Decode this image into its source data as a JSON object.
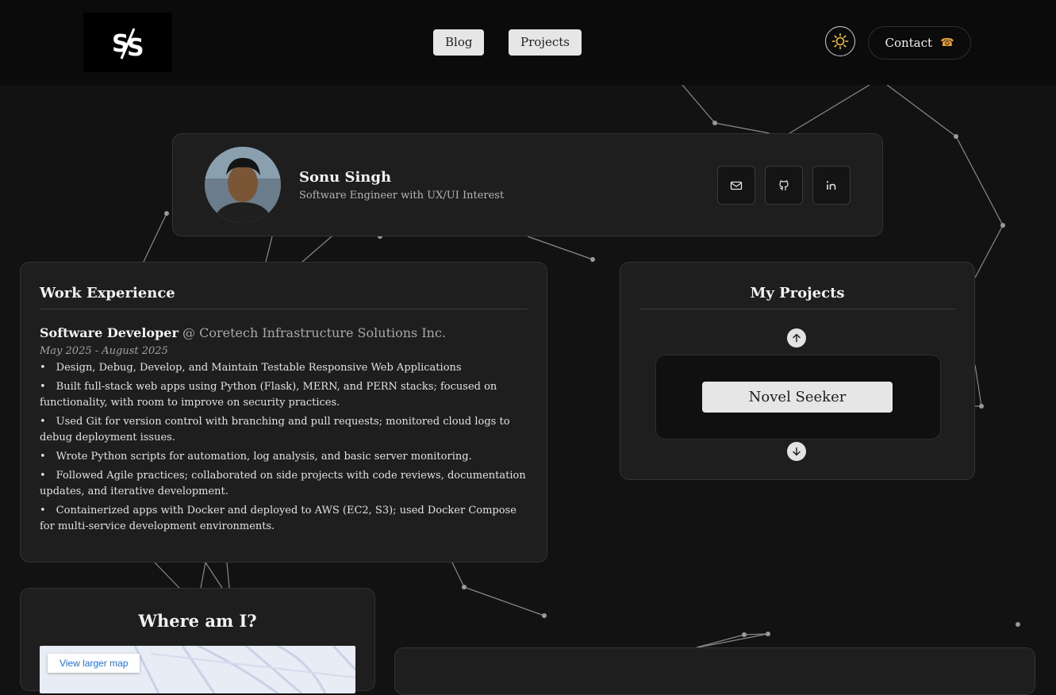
{
  "header": {
    "logo_text": "S/S",
    "nav": [
      {
        "label": "Blog"
      },
      {
        "label": "Projects"
      }
    ],
    "theme_icon": "sun-icon",
    "contact": {
      "label": "Contact",
      "icon": "telephone-icon",
      "icon_char": "☎"
    }
  },
  "profile": {
    "name": "Sonu Singh",
    "title": "Software Engineer with UX/UI Interest",
    "social": [
      "mail-icon",
      "github-icon",
      "linkedin-icon"
    ]
  },
  "work": {
    "heading": "Work Experience",
    "role": "Software Developer",
    "company": "@ Coretech Infrastructure Solutions Inc.",
    "dates": "May 2025 - August 2025",
    "bullets": [
      "Design, Debug, Develop, and Maintain Testable Responsive Web Applications",
      "Built full-stack web apps using Python (Flask), MERN, and PERN stacks; focused on functionality, with room to improve on security practices.",
      "Used Git for version control with branching and pull requests; monitored cloud logs to debug deployment issues.",
      "Wrote Python scripts for automation, log analysis, and basic server monitoring.",
      "Followed Agile practices; collaborated on side projects with code reviews, documentation updates, and iterative development.",
      "Containerized apps with Docker and deployed to AWS (EC2, S3); used Docker Compose for multi-service development environments."
    ]
  },
  "projects": {
    "heading": "My Projects",
    "current": "Novel Seeker",
    "up_icon": "arrow-up-icon",
    "down_icon": "arrow-down-icon"
  },
  "where": {
    "heading": "Where am I?",
    "map_link": "View larger map"
  },
  "colors": {
    "background": "#121212",
    "header": "#0b0b0b",
    "card": "#1e1e1e",
    "button": "#e6e6e6",
    "sun": "#f5c242"
  }
}
